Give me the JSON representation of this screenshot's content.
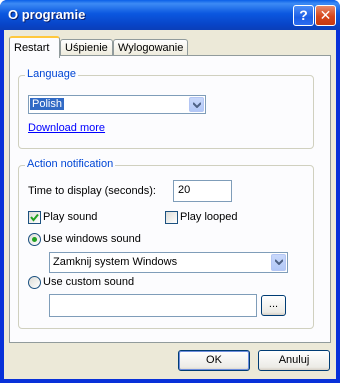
{
  "window": {
    "title": "O programie"
  },
  "titlebar_buttons": {
    "help": "?",
    "close": "✕"
  },
  "tabs": [
    {
      "label": "Restart",
      "active": true
    },
    {
      "label": "Uśpienie",
      "active": false
    },
    {
      "label": "Wylogowanie",
      "active": false
    }
  ],
  "language": {
    "legend": "Language",
    "selected": "Polish",
    "download_link": "Download more"
  },
  "notification": {
    "legend": "Action notification",
    "time_label": "Time to display (seconds):",
    "time_value": "20",
    "play_sound": {
      "label": "Play sound",
      "checked": true
    },
    "play_looped": {
      "label": "Play looped",
      "checked": false
    },
    "use_windows_sound": {
      "label": "Use windows sound",
      "selected": true
    },
    "windows_sound_value": "Zamknij system Windows",
    "use_custom_sound": {
      "label": "Use custom sound",
      "selected": false
    },
    "custom_sound_path": "",
    "browse_label": "..."
  },
  "buttons": {
    "ok": "OK",
    "cancel": "Anuluj"
  },
  "colors": {
    "titlebar": "#0b58e0",
    "dialog_bg": "#ece9d8",
    "group_legend": "#0046d5",
    "link": "#0000ff",
    "selection": "#316ac5",
    "radio_dot": "#21a121",
    "active_tab_accent": "#ffc83c"
  }
}
